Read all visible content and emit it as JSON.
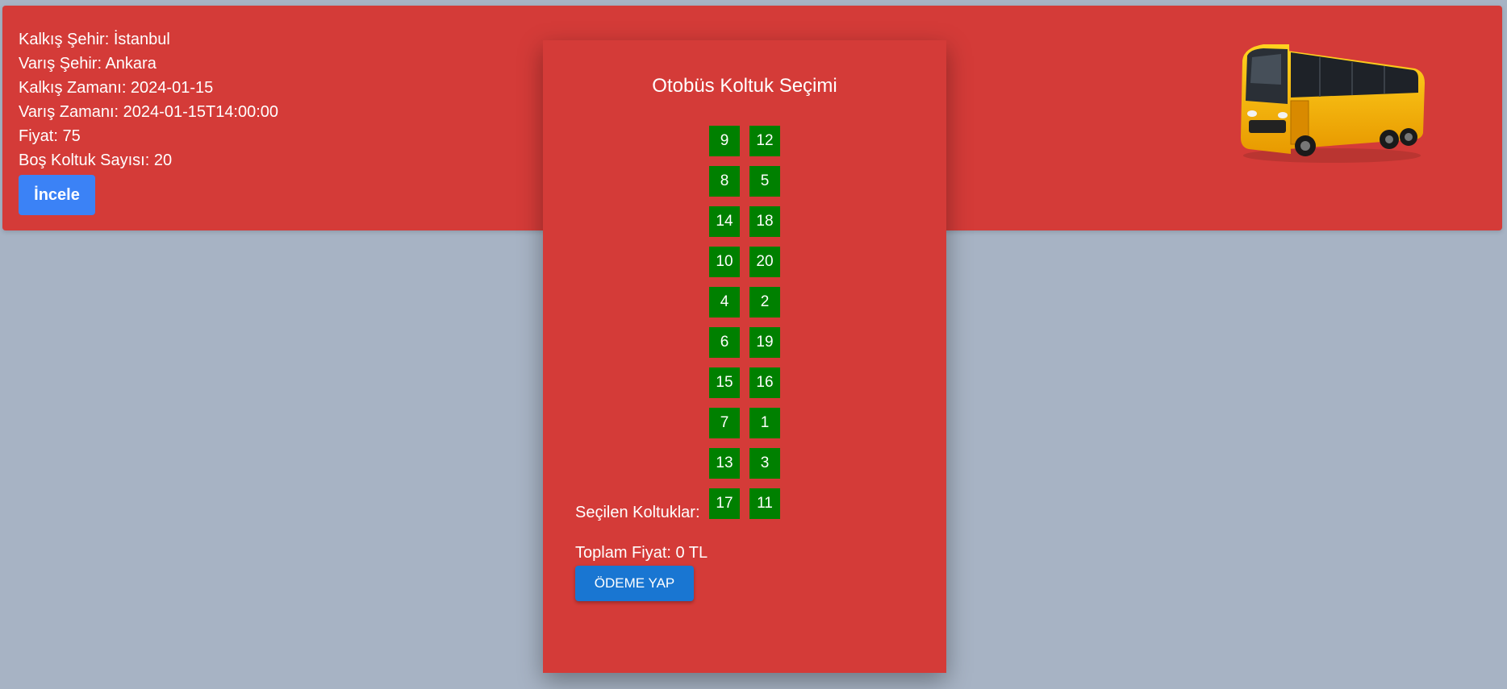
{
  "trip": {
    "departure_city": "Kalkış Şehir: İstanbul",
    "arrival_city": "Varış Şehir: Ankara",
    "departure_time": "Kalkış Zamanı: 2024-01-15",
    "arrival_time": "Varış Zamanı: 2024-01-15T14:00:00",
    "price": "Fiyat: 75",
    "empty_seats": "Boş Koltuk Sayısı: 20",
    "inspect_button": "İncele"
  },
  "modal": {
    "title": "Otobüs Koltuk Seçimi",
    "seats": [
      "9",
      "12",
      "8",
      "5",
      "14",
      "18",
      "10",
      "20",
      "4",
      "2",
      "6",
      "19",
      "15",
      "16",
      "7",
      "1",
      "13",
      "3",
      "17",
      "11"
    ],
    "seat_color": "#008000",
    "selected_seats_label": "Seçilen Koltuklar:",
    "total_price_label": "Toplam Fiyat: 0 TL",
    "pay_button": "ÖDEME YAP"
  },
  "colors": {
    "card_background": "#d43b38",
    "page_background": "#a7b3c4",
    "inspect_button": "#3b82f6",
    "pay_button": "#1976d2",
    "bus_body": "#f7b500"
  },
  "icons": {
    "bus_image": "bus-icon"
  }
}
